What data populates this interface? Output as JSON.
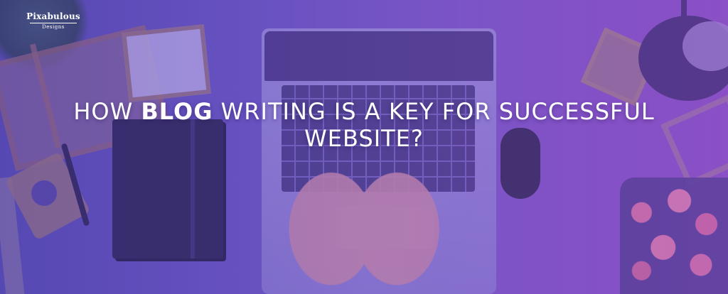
{
  "logo": {
    "name": "Pixabulous",
    "sub": "Designs"
  },
  "headline": {
    "part1": "HOW ",
    "bold": "BLOG",
    "part2": " WRITING IS A KEY FOR SUCCESSFUL",
    "line2": "WEBSITE?"
  },
  "colors": {
    "overlay_left": "#5b4fb8",
    "overlay_right": "#8a4fc4",
    "text": "#ffffff"
  }
}
